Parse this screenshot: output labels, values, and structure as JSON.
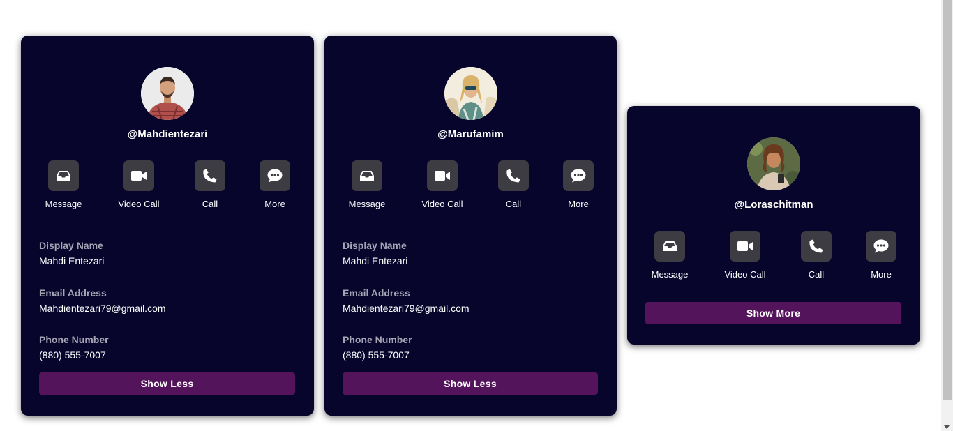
{
  "action_labels": {
    "message": "Message",
    "video_call": "Video Call",
    "call": "Call",
    "more": "More"
  },
  "field_labels": {
    "display_name": "Display Name",
    "email": "Email Address",
    "phone": "Phone Number"
  },
  "cards": [
    {
      "username": "@Mahdientezari",
      "display_name": "Mahdi Entezari",
      "email": "Mahdientezari79@gmail.com",
      "phone": "(880) 555-7007",
      "toggle_label": "Show Less",
      "expanded": true
    },
    {
      "username": "@Marufamim",
      "display_name": "Mahdi Entezari",
      "email": "Mahdientezari79@gmail.com",
      "phone": "(880) 555-7007",
      "toggle_label": "Show Less",
      "expanded": true
    },
    {
      "username": "@Loraschitman",
      "toggle_label": "Show More",
      "expanded": false
    }
  ],
  "icons": {
    "message": "inbox-icon",
    "video_call": "video-camera-icon",
    "call": "phone-icon",
    "more": "comment-dots-icon"
  },
  "colors": {
    "card_background": "#07052c",
    "action_button": "#3d3c42",
    "toggle_button": "#54145c",
    "field_label": "#a7a4b5"
  }
}
